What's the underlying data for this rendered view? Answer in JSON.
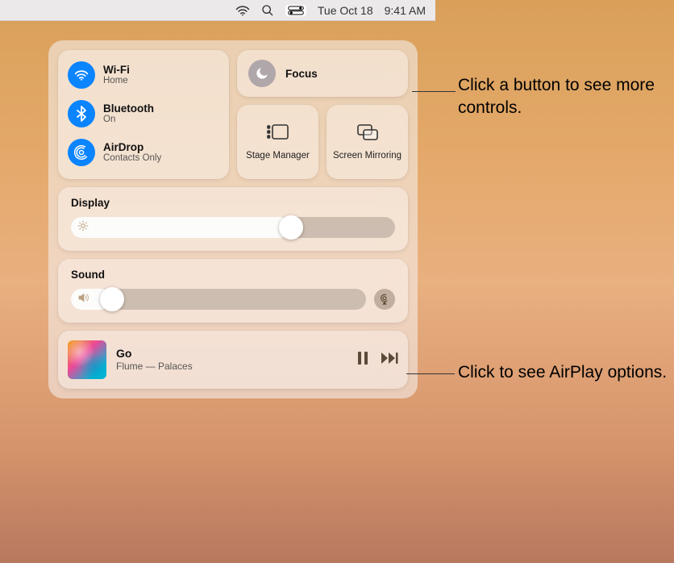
{
  "menubar": {
    "date": "Tue Oct 18",
    "time": "9:41 AM"
  },
  "connectivity": {
    "wifi": {
      "title": "Wi-Fi",
      "subtitle": "Home"
    },
    "bluetooth": {
      "title": "Bluetooth",
      "subtitle": "On"
    },
    "airdrop": {
      "title": "AirDrop",
      "subtitle": "Contacts Only"
    }
  },
  "focus": {
    "title": "Focus"
  },
  "stage": {
    "label": "Stage Manager"
  },
  "mirror": {
    "label": "Screen Mirroring"
  },
  "display": {
    "title": "Display",
    "value_pct": 68
  },
  "sound": {
    "title": "Sound",
    "value_pct": 14
  },
  "music": {
    "title": "Go",
    "subtitle": "Flume — Palaces"
  },
  "callouts": {
    "focus": "Click a button to see more controls.",
    "airplay": "Click to see AirPlay options."
  }
}
